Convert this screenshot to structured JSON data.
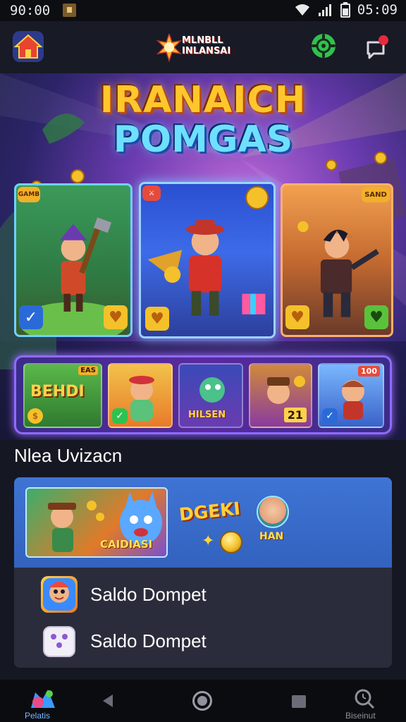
{
  "status_bar": {
    "time_left": "90:00",
    "time_right": "05:09"
  },
  "top_bar": {
    "logo_text": "MLNBLL INLANSAI",
    "icons": [
      "home-icon",
      "settings-gear-icon",
      "chat-notification-icon"
    ],
    "accent_colors": {
      "settings": "#3bd05a",
      "notification_dot": "#e62b3a"
    }
  },
  "hero": {
    "title_line1": "IRANAICH",
    "title_line2": "POMGAS",
    "card_left_badge": "GAMB",
    "card_right_badge": "SAND",
    "thumbnails": [
      {
        "label": "BEHDI",
        "badge": "EAS"
      },
      {
        "label": ""
      },
      {
        "label": "HILSEN"
      },
      {
        "label": "21"
      },
      {
        "label": "",
        "badge": "100"
      }
    ]
  },
  "section": {
    "title": "Nlea Uvizacn"
  },
  "panel": {
    "promo": {
      "thumb_label": "CAIDIASI",
      "badge_text": "DGEKI",
      "avatar_label": "HAN"
    },
    "wallet_rows": [
      {
        "label": "Saldo Dompet",
        "icon": "game-avatar-icon"
      },
      {
        "label": "Saldo Dompet",
        "icon": "dice-icon"
      }
    ]
  },
  "bottom_nav": {
    "left_label": "Pelatis",
    "right_label": "Biseinut",
    "icons": [
      "app-logo-icon",
      "back-icon",
      "home-circle-icon",
      "recent-apps-icon",
      "search-history-icon"
    ]
  }
}
